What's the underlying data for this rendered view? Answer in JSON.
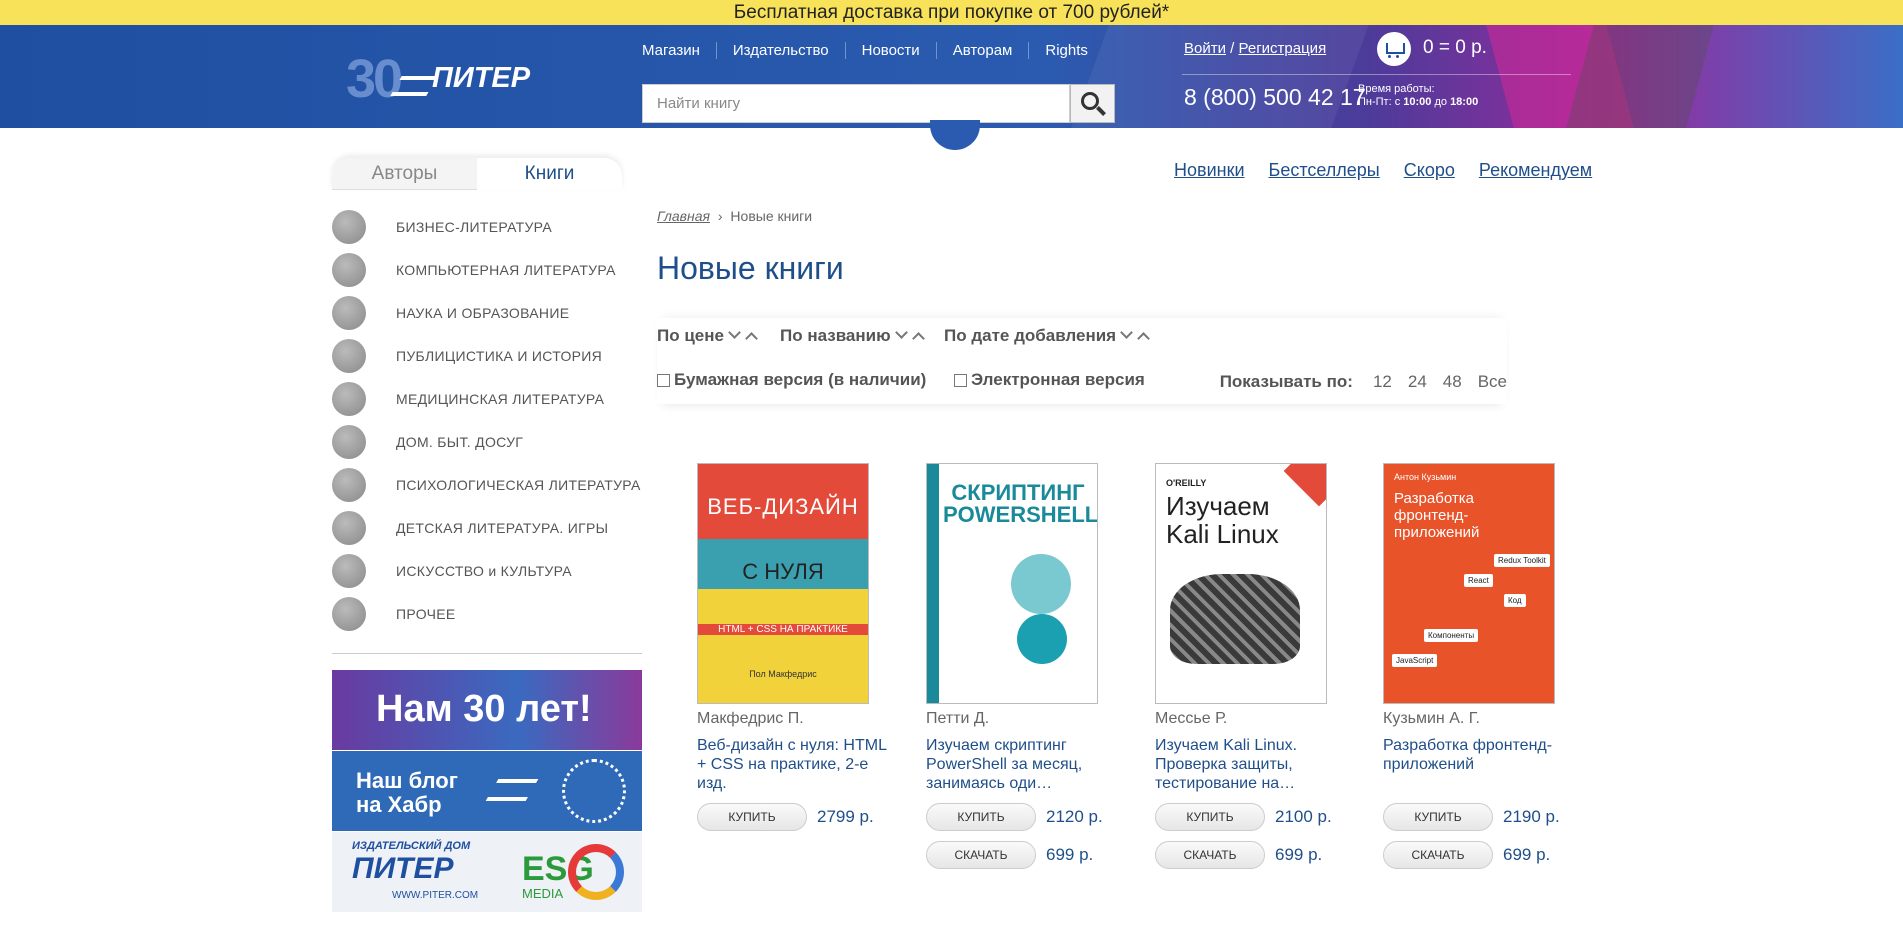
{
  "promo": "Бесплатная доставка при покупке от 700 рублей*",
  "logo": {
    "anniversary": "30",
    "brand": "ПИТЕР"
  },
  "nav": [
    "Магазин",
    "Издательство",
    "Новости",
    "Авторам",
    "Rights"
  ],
  "search": {
    "placeholder": "Найти книгу"
  },
  "auth": {
    "login": "Войти",
    "sep": " / ",
    "register": "Регистрация"
  },
  "cart": {
    "total": "0 = 0 р."
  },
  "contact": {
    "phone": "8 (800) 500 42 17",
    "hours_label": "Время работы:",
    "hours_days": "Пн-Пт: с ",
    "hours_from": "10:00",
    "hours_to_word": " до ",
    "hours_to": "18:00"
  },
  "side_tabs": {
    "authors": "Авторы",
    "books": "Книги"
  },
  "categories": [
    {
      "label": "БИЗНЕС-ЛИТЕРАТУРА",
      "icon": "business-icon"
    },
    {
      "label": "КОМПЬЮТЕРНАЯ ЛИТЕРАТУРА",
      "icon": "computer-icon"
    },
    {
      "label": "НАУКА И ОБРАЗОВАНИЕ",
      "icon": "science-icon"
    },
    {
      "label": "ПУБЛИЦИСТИКА И ИСТОРИЯ",
      "icon": "pen-icon"
    },
    {
      "label": "МЕДИЦИНСКАЯ ЛИТЕРАТУРА",
      "icon": "medicine-icon"
    },
    {
      "label": "ДОМ. БЫТ. ДОСУГ",
      "icon": "home-icon"
    },
    {
      "label": "ПСИХОЛОГИЧЕСКАЯ ЛИТЕРАТУРА",
      "icon": "psi-icon"
    },
    {
      "label": "ДЕТСКАЯ ЛИТЕРАТУРА. ИГРЫ",
      "icon": "pyramid-icon"
    },
    {
      "label": "ИСКУССТВО и КУЛЬТУРА",
      "icon": "art-icon"
    },
    {
      "label": "ПРОЧЕЕ",
      "icon": "scales-icon"
    }
  ],
  "banners": {
    "anniversary": "Нам 30 лет!",
    "blog": "Наш блог на Хабр",
    "publisher_small": "ИЗДАТЕЛЬСКИЙ ДОМ",
    "publisher": "ПИТЕР",
    "publisher_url": "WWW.PITER.COM",
    "esg": "ESG",
    "media": "MEDIA"
  },
  "quick_links": [
    "Новинки",
    "Бестселлеры",
    "Скоро",
    "Рекомендуем"
  ],
  "breadcrumb": {
    "home": "Главная",
    "sep": "›",
    "current": "Новые книги"
  },
  "page_title": "Новые книги",
  "sort": {
    "price": "По цене",
    "name": "По названию",
    "date": "По дате добавления"
  },
  "filters": {
    "paper": "Бумажная версия (в наличии)",
    "ebook": "Электронная версия"
  },
  "per_page": {
    "label": "Показывать по:",
    "options": [
      "12",
      "24",
      "48",
      "Все"
    ]
  },
  "buy_label": "КУПИТЬ",
  "download_label": "СКАЧАТЬ",
  "books": [
    {
      "author": "Макфедрис П.",
      "title": "Веб-дизайн с нуля: HTML + CSS на практике, 2-е изд.",
      "price": "2799 р.",
      "ebook_price": null,
      "cover": {
        "line1": "ВЕБ-ДИЗАЙН",
        "line2": "С НУЛЯ",
        "line3": "HTML + CSS  НА ПРАКТИКЕ",
        "line4": "Пол Макфедрис"
      }
    },
    {
      "author": "Петти Д.",
      "title": "Изучаем скриптинг PowerShell за месяц, занимаясь оди…",
      "price": "2120 р.",
      "ebook_price": "699 р.",
      "cover": {
        "line1": "СКРИПТИНГ POWERSHELL"
      }
    },
    {
      "author": "Мессье Р.",
      "title": "Изучаем Kali Linux. Проверка защиты, тестирование на…",
      "price": "2100 р.",
      "ebook_price": "699 р.",
      "cover": {
        "line1": "O'REILLY",
        "line2": "Изучаем Kali Linux"
      }
    },
    {
      "author": "Кузьмин А. Г.",
      "title": "Разработка фронтенд-приложений",
      "price": "2190 р.",
      "ebook_price": "699 р.",
      "cover": {
        "line1": "Антон Кузьмин",
        "line2": "Разработка фронтенд-приложений",
        "tags": [
          "React",
          "Redux Toolkit",
          "Код",
          "Компоненты",
          "JavaScript"
        ]
      }
    }
  ]
}
